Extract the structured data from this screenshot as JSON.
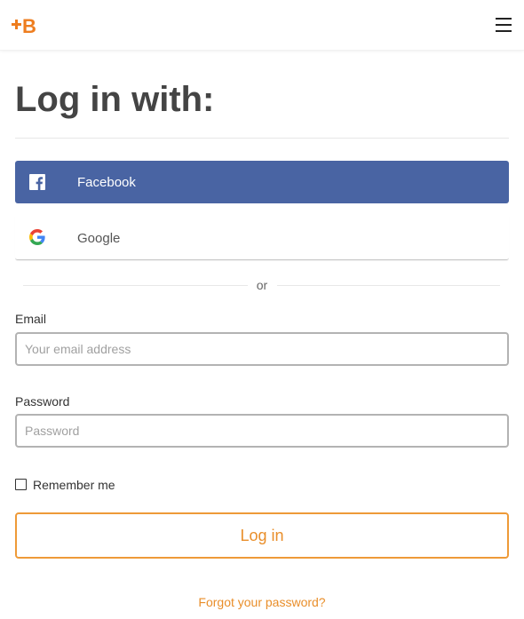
{
  "app": {
    "logo_icon": "babbel-logo-icon",
    "menu_icon": "hamburger-menu-icon"
  },
  "colors": {
    "accent": "#ee9a38",
    "facebook": "#4964a3",
    "title": "#444444",
    "input_border": "#b3b3b3"
  },
  "login": {
    "title": "Log in with:",
    "facebook_label": "Facebook",
    "facebook_icon": "facebook-icon",
    "google_label": "Google",
    "google_icon": "google-icon",
    "or_text": "or",
    "email_label": "Email",
    "email_value": "",
    "email_placeholder": "Your email address",
    "password_label": "Password",
    "password_value": "",
    "password_placeholder": "Password",
    "remember_label": "Remember me",
    "remember_checked": false,
    "submit_label": "Log in",
    "forgot_label": "Forgot your password?"
  }
}
